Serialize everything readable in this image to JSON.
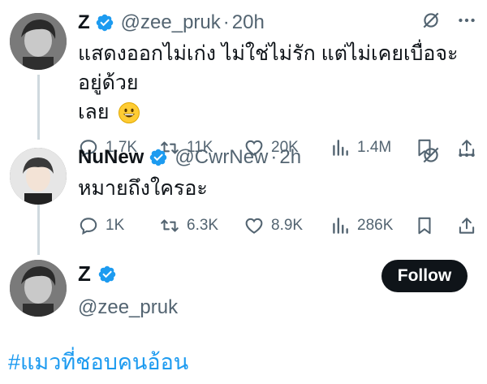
{
  "colors": {
    "link": "#1d9bf0",
    "text": "#0f1419",
    "muted": "#536471",
    "follow_bg": "#0f1419"
  },
  "tweets": [
    {
      "name": "Z",
      "handle": "@zee_pruk",
      "dot": "·",
      "time": "20h",
      "text_line1": "แสดงออกไม่เก่ง ไม่ใช่ไม่รัก แต่ไม่เคยเบื่อจะอยู่ด้วย",
      "text_line2": "เลย",
      "emoji": "grinning-face",
      "replies": "1.7K",
      "retweets": "11K",
      "likes": "20K",
      "views": "1.4M"
    },
    {
      "name": "NuNew",
      "handle": "@CwrNew",
      "dot": "·",
      "time": "2h",
      "text_line1": "หมายถึงใครอะ",
      "replies": "1K",
      "retweets": "6.3K",
      "likes": "8.9K",
      "views": "286K"
    }
  ],
  "profile": {
    "name": "Z",
    "handle": "@zee_pruk",
    "follow_label": "Follow"
  },
  "hashtag": "#แมวที่ชอบคนอ้อน"
}
